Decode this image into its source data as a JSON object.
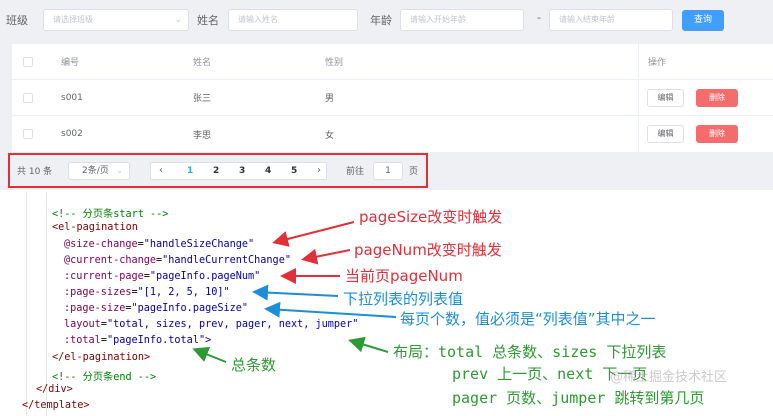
{
  "filters": {
    "class_label": "班级",
    "class_placeholder": "请选择班级",
    "name_label": "姓名",
    "name_placeholder": "请输入姓名",
    "age_label": "年龄",
    "age_start_placeholder": "请输入开始年龄",
    "age_separator": "-",
    "age_end_placeholder": "请输入结束年龄",
    "query_button": "查询"
  },
  "table": {
    "columns": [
      "编号",
      "姓名",
      "性别",
      "操作"
    ],
    "rows": [
      {
        "id": "s001",
        "name": "张三",
        "gender": "男",
        "edit": "编辑",
        "delete": "删除"
      },
      {
        "id": "s002",
        "name": "李思",
        "gender": "女",
        "edit": "编辑",
        "delete": "删除"
      }
    ]
  },
  "pagination": {
    "total": "共 10 条",
    "page_size": "2条/页",
    "pages": [
      "1",
      "2",
      "3",
      "4",
      "5"
    ],
    "current_page": "1",
    "prev_icon": "chevron-left-icon",
    "next_icon": "chevron-right-icon",
    "goto_label": "前往",
    "goto_value": "1",
    "page_unit": "页"
  },
  "code": {
    "lines": [
      {
        "indent": "    ",
        "text": "<!-- 分页条start -->",
        "kind": "comment"
      },
      {
        "indent": "    ",
        "text": "<el-pagination",
        "kind": "tag"
      },
      {
        "indent": "      ",
        "attr": "@size-change",
        "value": "\"handleSizeChange\"",
        "kind": "attr"
      },
      {
        "indent": "      ",
        "attr": "@current-change",
        "value": "\"handleCurrentChange\"",
        "kind": "attr"
      },
      {
        "indent": "      ",
        "attr": ":current-page",
        "value": "\"pageInfo.pageNum\"",
        "kind": "attr"
      },
      {
        "indent": "      ",
        "attr": ":page-sizes",
        "value": "\"[1, 2, 5, 10]\"",
        "kind": "attr"
      },
      {
        "indent": "      ",
        "attr": ":page-size",
        "value": "\"pageInfo.pageSize\"",
        "kind": "attr"
      },
      {
        "indent": "      ",
        "attr": "layout",
        "value": "\"total, sizes, prev, pager, next, jumper\"",
        "kind": "attr"
      },
      {
        "indent": "      ",
        "attr": ":total",
        "value": "\"pageInfo.total\">",
        "kind": "attr"
      },
      {
        "indent": "    ",
        "text": "</el-pagination>",
        "kind": "tag"
      },
      {
        "indent": "    ",
        "text": "<!-- 分页条end -->",
        "kind": "comment"
      },
      {
        "indent": "  ",
        "text": "</div>",
        "kind": "tag"
      },
      {
        "indent": "",
        "text": "</template>",
        "kind": "tag"
      }
    ]
  },
  "annotations": {
    "page_size_change": "pageSize改变时触发",
    "page_num_change": "pageNum改变时触发",
    "current_page": "当前页pageNum",
    "page_sizes": "下拉列表的列表值",
    "page_size": "每页个数，值必须是“列表值”其中之一",
    "layout_line1": "布局：total 总条数、sizes 下拉列表",
    "layout_line2": "prev 上一页、next 下一页",
    "layout_line3": "pager 页数、jumper 跳转到第几页",
    "total": "总条数",
    "watermark": "@稀土掘金技术社区"
  },
  "colors": {
    "primary": "#409eff",
    "danger": "#f56c6c",
    "highlight_red": "#e0303a",
    "annotation_blue": "#1b8ed8",
    "annotation_green": "#2e9a32"
  }
}
